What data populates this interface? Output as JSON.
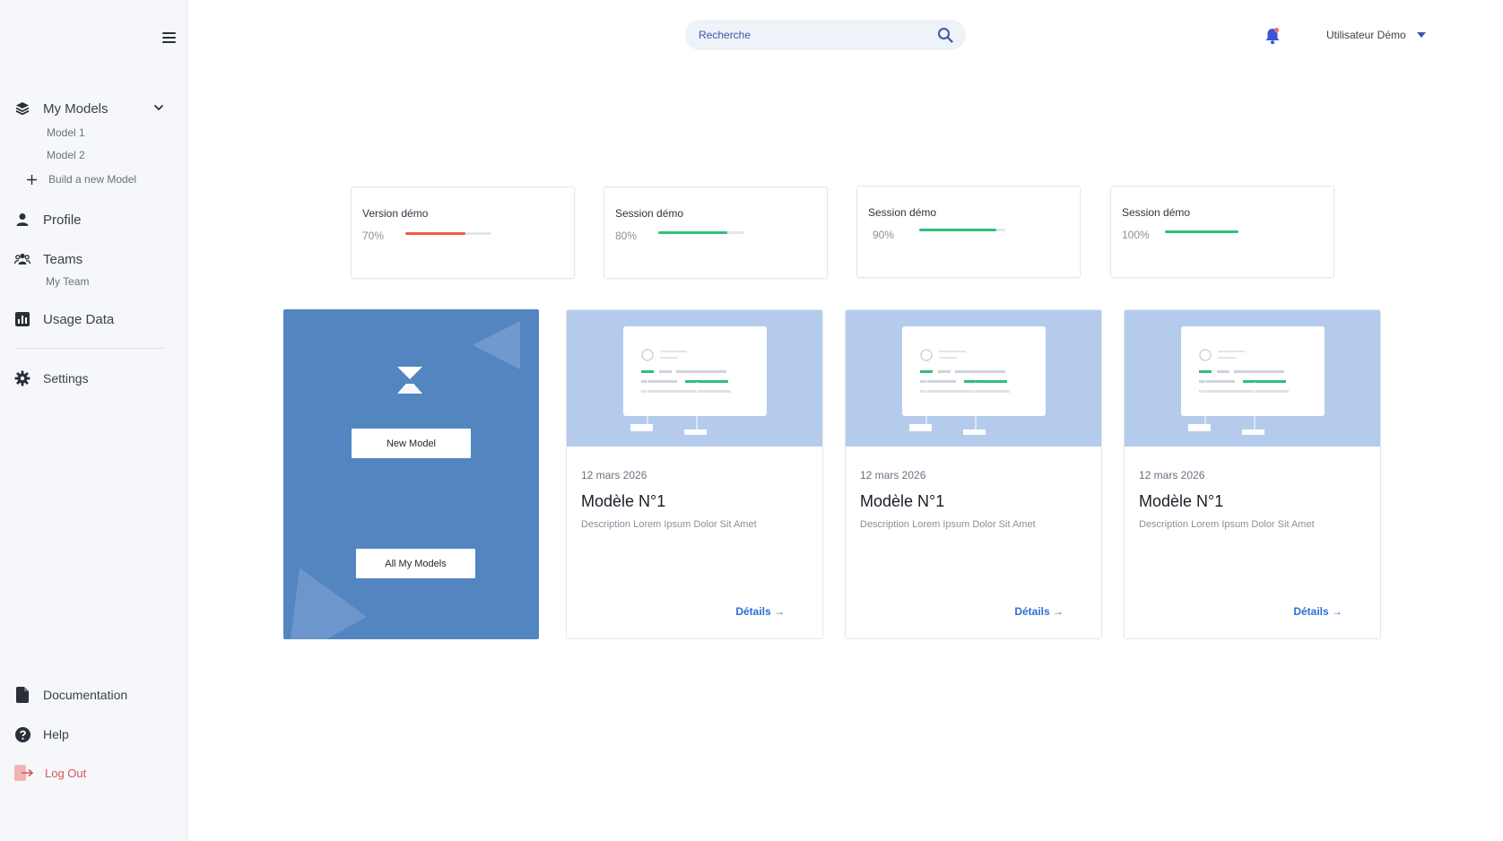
{
  "sidebar": {
    "my_models": {
      "label": "My Models",
      "items": [
        "Model 1",
        "Model 2"
      ],
      "build_label": "Build a new Model"
    },
    "profile": "Profile",
    "teams": {
      "label": "Teams",
      "items": [
        "My Team"
      ]
    },
    "usage": "Usage Data",
    "settings": "Settings",
    "documentation": "Documentation",
    "help": "Help",
    "logout": "Log Out"
  },
  "header": {
    "search_placeholder": "Recherche",
    "user_name": "Utilisateur Démo"
  },
  "stats": [
    {
      "title": "Version démo",
      "percent": "70%",
      "value": 0.7,
      "color": "#ef5a3c"
    },
    {
      "title": "Session démo",
      "percent": "80%",
      "value": 0.8,
      "color": "#2fbf7a"
    },
    {
      "title": "Session démo",
      "percent": "90%",
      "value": 0.9,
      "color": "#2fbf7a"
    },
    {
      "title": "Session démo",
      "percent": "100%",
      "value": 1.0,
      "color": "#2fbf7a"
    }
  ],
  "cta_card": {
    "new_model": "New Model",
    "all_models": "All My Models"
  },
  "models": [
    {
      "date": "12 mars 2026",
      "title": "Modèle N°1",
      "description": "Description Lorem Ipsum Dolor Sit Amet",
      "details": "Détails →"
    },
    {
      "date": "12 mars 2026",
      "title": "Modèle N°1",
      "description": "Description Lorem Ipsum Dolor Sit Amet",
      "details": "Détails →"
    },
    {
      "date": "12 mars 2026",
      "title": "Modèle N°1",
      "description": "Description Lorem Ipsum Dolor Sit Amet",
      "details": "Détails →"
    }
  ],
  "colors": {
    "accent": "#5385c0",
    "link": "#2b6fd6",
    "danger": "#d6565a",
    "thumb": "#b4cbec"
  },
  "icons": [
    "menu-icon",
    "layers-icon",
    "chevron-down-icon",
    "plus-icon",
    "user-icon",
    "team-icon",
    "bar-chart-icon",
    "gear-icon",
    "document-icon",
    "help-icon",
    "logout-icon",
    "search-icon",
    "bell-icon",
    "caret-down-icon"
  ]
}
